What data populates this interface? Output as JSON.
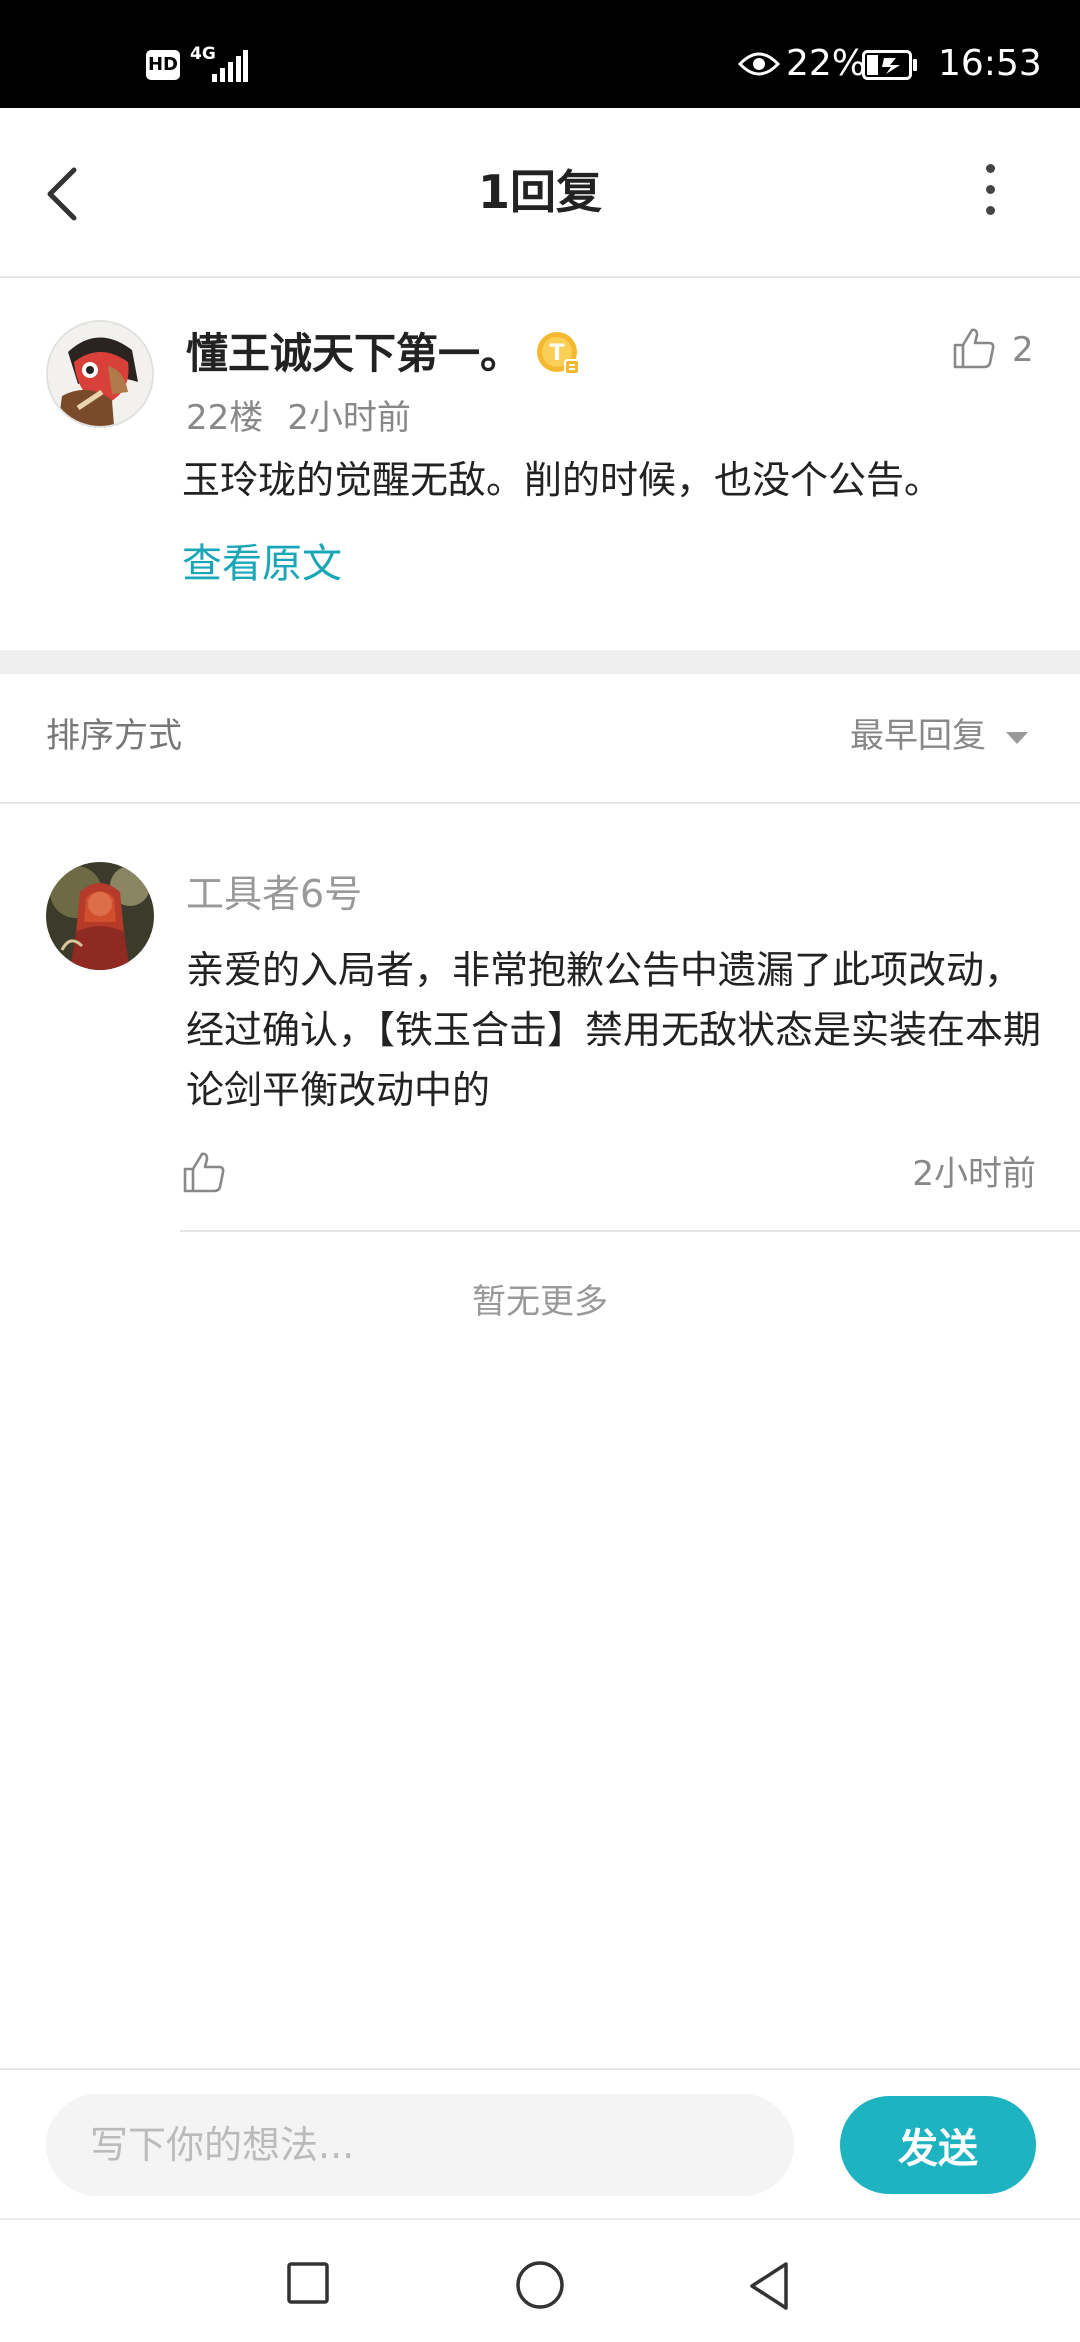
{
  "status_bar": {
    "hd": "HD",
    "network": "4G",
    "battery_percent": "22%",
    "time": "16:53",
    "icons": [
      "signal-icon",
      "eye-icon",
      "battery-icon"
    ]
  },
  "header": {
    "title": "1回复",
    "back_icon": "chevron-left-icon",
    "more_icon": "more-vertical-icon"
  },
  "original_post": {
    "username": "懂王诚天下第一。",
    "badge_icon": "gold-t-badge-icon",
    "floor": "22楼",
    "time": "2小时前",
    "content": "玉玲珑的觉醒无敌。削的时候，也没个公告。",
    "view_original_label": "查看原文",
    "like_count": "2",
    "like_icon": "thumbs-up-icon"
  },
  "sort": {
    "label": "排序方式",
    "selected": "最早回复",
    "caret_icon": "caret-down-icon"
  },
  "reply": {
    "username": "工具者6号",
    "content": "亲爱的入局者，非常抱歉公告中遗漏了此项改动，经过确认，【铁玉合击】禁用无敌状态是实装在本期论剑平衡改动中的",
    "time": "2小时前",
    "like_icon": "thumbs-up-icon"
  },
  "footer_note": "暂无更多",
  "composer": {
    "placeholder": "写下你的想法...",
    "send_label": "发送"
  },
  "colors": {
    "accent": "#1eb3c0",
    "link": "#19a7b8"
  }
}
